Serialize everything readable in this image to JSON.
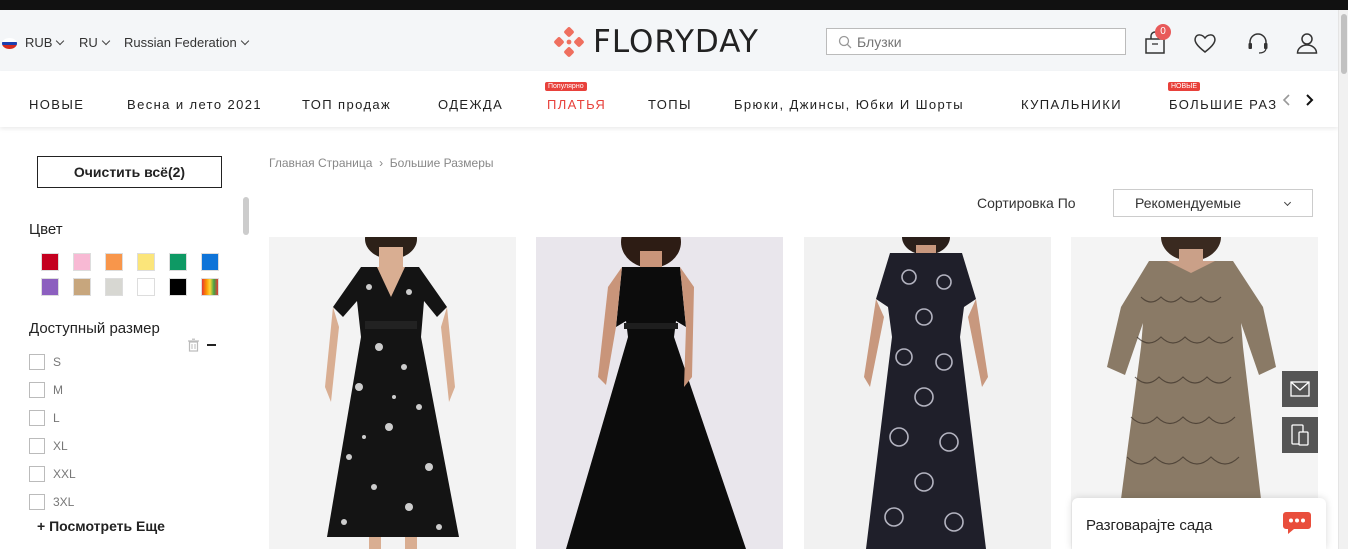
{
  "header": {
    "currency": "RUB",
    "language": "RU",
    "country": "Russian Federation",
    "logo_text": "FLORYDAY",
    "search_placeholder": "Блузки",
    "cart_count": "0"
  },
  "nav": {
    "items": [
      {
        "label": "НОВЫЕ"
      },
      {
        "label": "Весна и лето 2021"
      },
      {
        "label": "ТОП продаж"
      },
      {
        "label": "ОДЕЖДА"
      },
      {
        "label": "ПЛАТЬЯ",
        "tag": "Популярно"
      },
      {
        "label": "ТОПЫ"
      },
      {
        "label": "Брюки, Джинсы, Юбки И Шорты"
      },
      {
        "label": "КУПАЛЬНИКИ"
      },
      {
        "label": "БОЛЬШИЕ РАЗМЕРЫ",
        "tag": "НОВЫЕ"
      }
    ]
  },
  "sidebar": {
    "clear_label": "Очистить всё(2)",
    "color_title": "Цвет",
    "colors": [
      "#c4001f",
      "#f8b9d4",
      "#f8964b",
      "#fbe57a",
      "#0e9964",
      "#0f74d8",
      "#8c5fbf",
      "#c7a67d",
      "#d7d7d2",
      "#ffffff",
      "#000000",
      "multicolor"
    ],
    "size_title": "Доступный размер",
    "sizes": [
      "S",
      "M",
      "L",
      "XL",
      "XXL",
      "3XL"
    ],
    "more_label": "Посмотреть Еще"
  },
  "breadcrumb": {
    "home": "Главная Страница",
    "current": "Большие Размеры"
  },
  "sort": {
    "label": "Сортировка По",
    "value": "Рекомендуемые"
  },
  "products": [
    {
      "name": "floral-v-neck-dress",
      "color": "#111111"
    },
    {
      "name": "black-halter-maxi-dress",
      "color": "#0a0a0a"
    },
    {
      "name": "paisley-print-maxi-dress",
      "color": "#1c1c28"
    },
    {
      "name": "lace-midi-dress",
      "color": "#7d705f"
    }
  ],
  "chat": {
    "label": "Разговарајте сада"
  }
}
